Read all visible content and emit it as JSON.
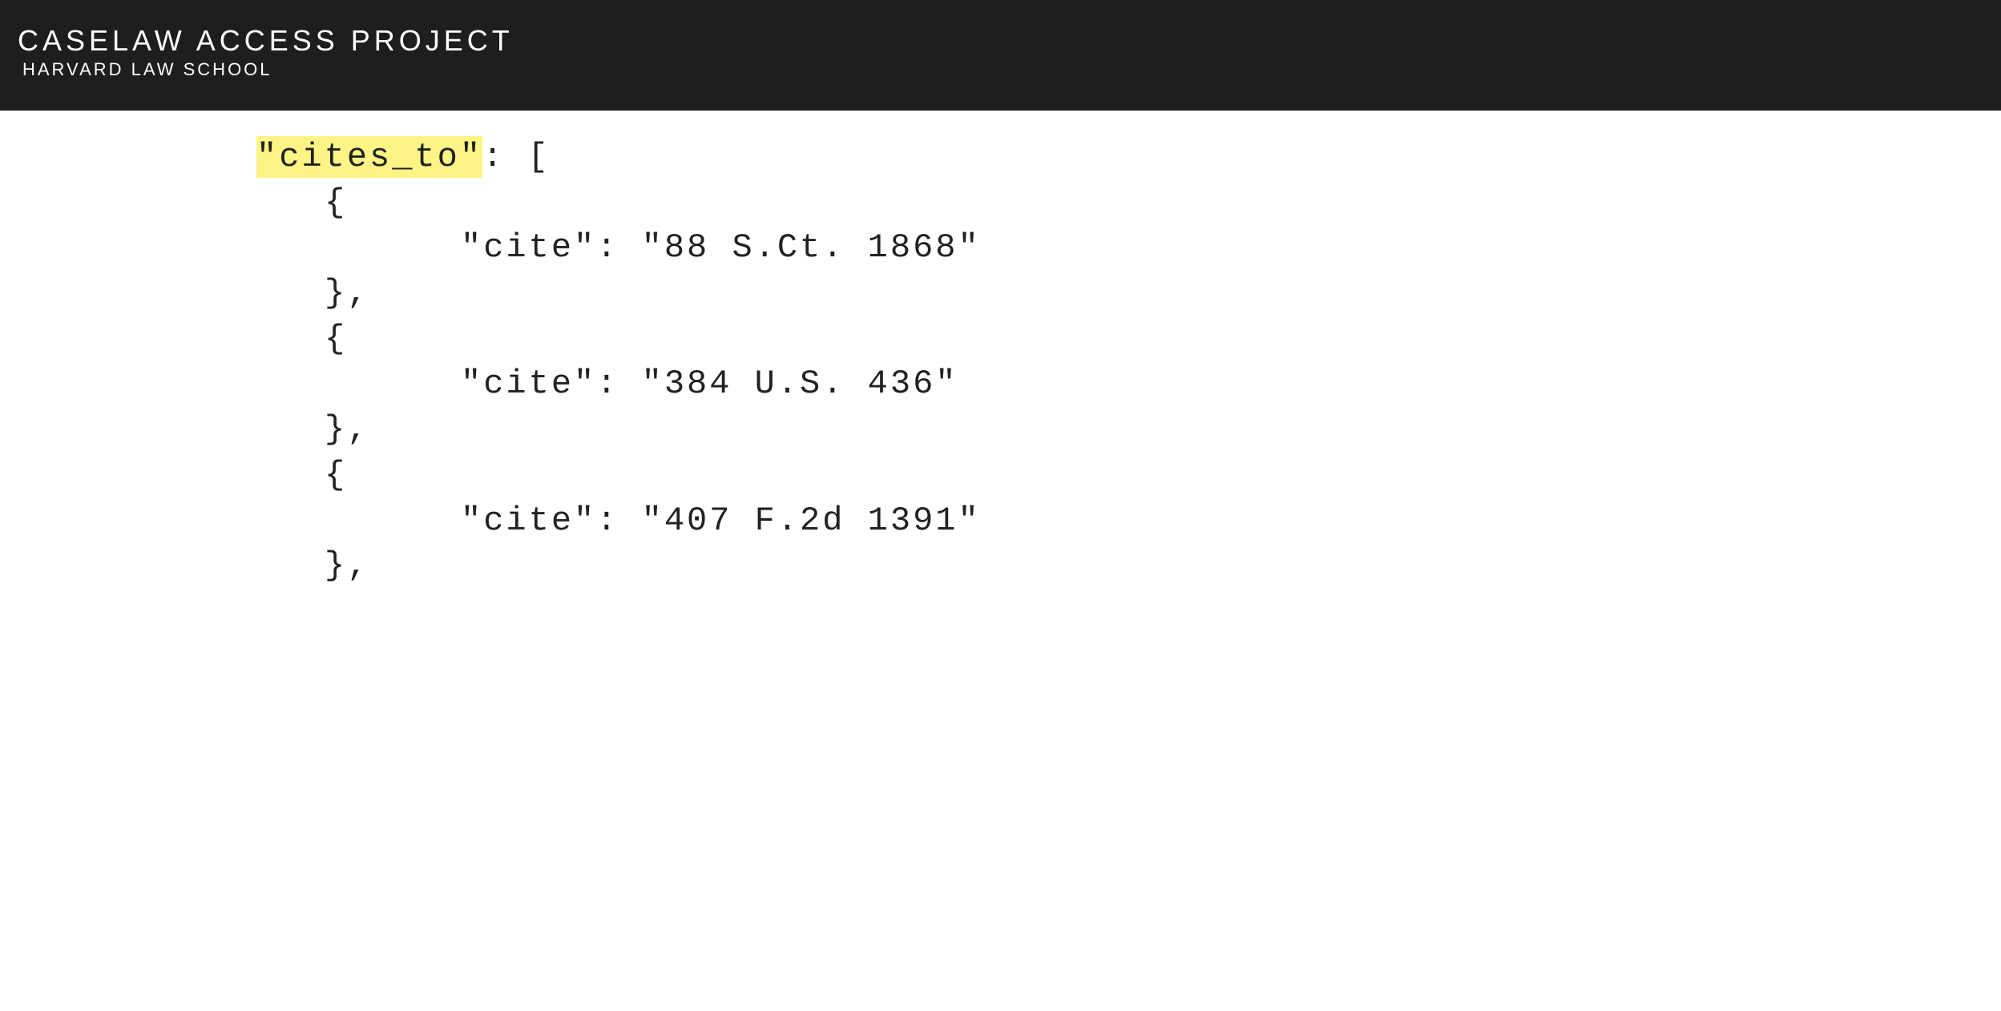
{
  "header": {
    "title": "CASELAW ACCESS PROJECT",
    "subtitle": "HARVARD LAW SCHOOL"
  },
  "code": {
    "key": "\"cites_to\"",
    "open": ": [",
    "brace_open": "{",
    "brace_close_comma": "},",
    "cites": [
      {
        "line": "\"cite\": \"88 S.Ct. 1868\""
      },
      {
        "line": "\"cite\": \"384 U.S. 436\""
      },
      {
        "line": "\"cite\": \"407 F.2d 1391\""
      }
    ]
  }
}
